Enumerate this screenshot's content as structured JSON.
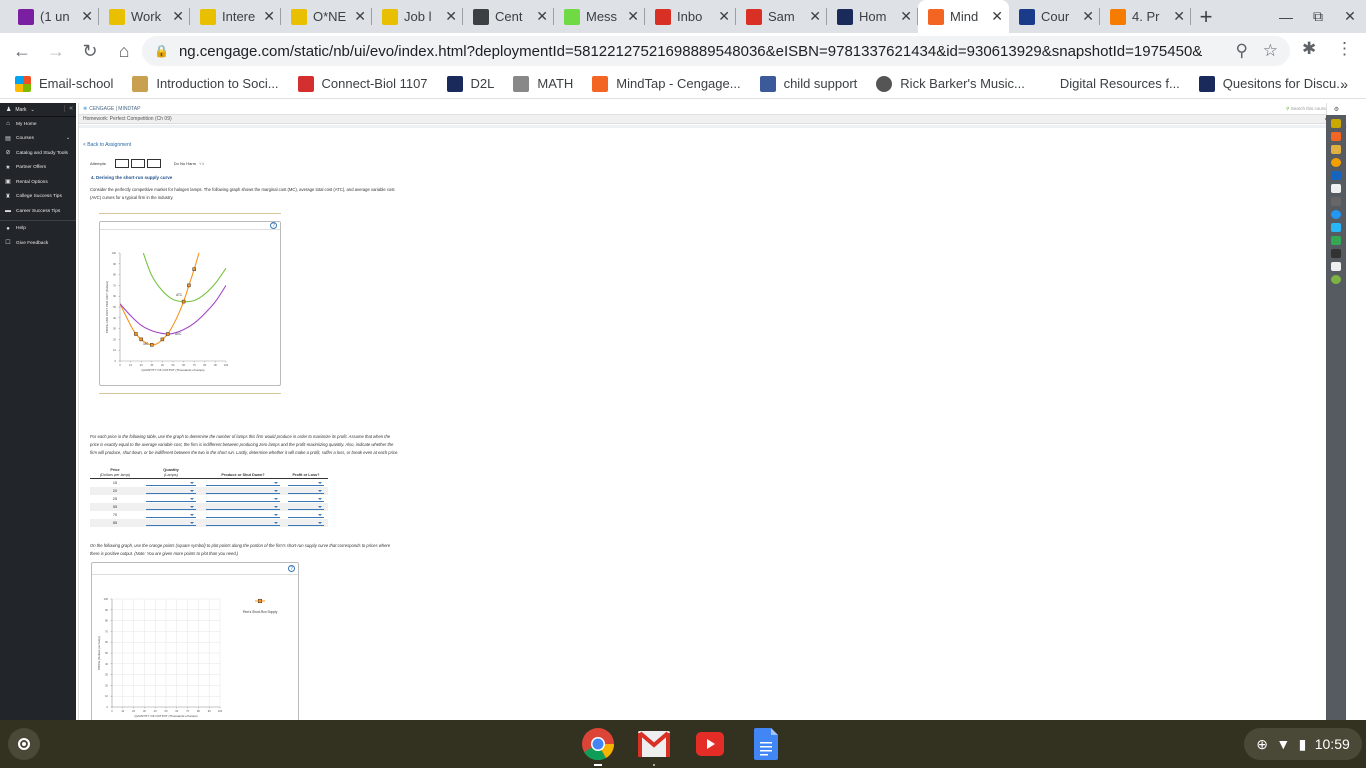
{
  "browser": {
    "tabs": [
      {
        "title": "(1 un",
        "icon": "mail-icon",
        "color": "#7b1fa2"
      },
      {
        "title": "Work",
        "icon": "onet-icon",
        "color": "#e8c000"
      },
      {
        "title": "Intere",
        "icon": "onet-icon",
        "color": "#e8c000"
      },
      {
        "title": "O*NE",
        "icon": "onet-icon",
        "color": "#e8c000"
      },
      {
        "title": "Job l",
        "icon": "onet-icon",
        "color": "#e8c000"
      },
      {
        "title": "Cent",
        "icon": "compass-icon",
        "color": "#3c4043"
      },
      {
        "title": "Mess",
        "icon": "upwork-icon",
        "color": "#6fda44"
      },
      {
        "title": "Inbo",
        "icon": "gmail-icon",
        "color": "#d93025"
      },
      {
        "title": "Sam",
        "icon": "gmail-icon",
        "color": "#d93025"
      },
      {
        "title": "Hom",
        "icon": "d2l-icon",
        "color": "#1a2a5a"
      },
      {
        "title": "Mind",
        "icon": "mindtap-icon",
        "color": "#f26522",
        "active": true
      },
      {
        "title": "Cour",
        "icon": "shield-icon",
        "color": "#1a3a8a"
      },
      {
        "title": "4. Pr",
        "icon": "cengage-c-icon",
        "color": "#f57c00"
      }
    ],
    "url": "ng.cengage.com/static/nb/ui/evo/index.html?deploymentId=58122127521698889548036&eISBN=9781337621434&id=930613929&snapshotId=1975450&",
    "bookmarks": [
      {
        "label": "Email-school",
        "icon": "microsoft-icon"
      },
      {
        "label": "Introduction to Soci...",
        "icon": "books-icon"
      },
      {
        "label": "Connect-Biol 1107",
        "icon": "mcgraw-hill-icon"
      },
      {
        "label": "D2L",
        "icon": "d2l-icon"
      },
      {
        "label": "MATH",
        "icon": "tablet-icon"
      },
      {
        "label": "MindTap - Cengage...",
        "icon": "mindtap-icon"
      },
      {
        "label": "child support",
        "icon": "hhs-icon"
      },
      {
        "label": "Rick Barker's Music...",
        "icon": "globe-icon"
      },
      {
        "label": "Digital Resources f...",
        "icon": ""
      },
      {
        "label": "Quesitons for Discu...",
        "icon": "d2l-icon"
      }
    ]
  },
  "sidebar": {
    "user": "Mark",
    "items": [
      {
        "label": "My Home",
        "icon": "home-icon"
      },
      {
        "label": "Courses",
        "icon": "courses-icon"
      },
      {
        "label": "Catalog and Study Tools",
        "icon": "catalog-icon"
      },
      {
        "label": "Partner Offers",
        "icon": "star-icon"
      },
      {
        "label": "Rental Options",
        "icon": "rental-icon"
      },
      {
        "label": "College Success Tips",
        "icon": "grad-cap-icon"
      },
      {
        "label": "Career Success Tips",
        "icon": "briefcase-icon"
      },
      {
        "label": "Help",
        "icon": "help-icon"
      },
      {
        "label": "Give Feedback",
        "icon": "feedback-icon"
      }
    ]
  },
  "header": {
    "brand": "CENGAGE | MINDTAP",
    "search_placeholder": "Search this course",
    "assignment_title": "Homework: Perfect Competition (Ch 09)"
  },
  "content": {
    "back_link": "< Back to Assignment",
    "attempts_label": "Attempts",
    "do_no_harm_label": "Do No Harm",
    "do_no_harm_value": "Y4",
    "question_title": "4. Deriving the short-run supply curve",
    "intro": "Consider the perfectly competitive market for halogen lamps. The following graph shows the marginal cost (MC), average total cost (ATC), and average variable cost (AVC) curves for a typical firm in the industry.",
    "table_instructions": "For each price in the following table, use the graph to determine the number of lamps this firm would produce in order to maximize its profit. Assume that when the price is exactly equal to the average variable cost, the firm is indifferent between producing zero lamps and the profit-maximizing quantity. Also, indicate whether the firm will produce, shut down, or be indifferent between the two in the short run. Lastly, determine whether it will make a profit, suffer a loss, or break even at each price.",
    "table": {
      "headers": {
        "price": "Price",
        "price_unit": "(Dollars per lamp)",
        "quantity": "Quantity",
        "quantity_unit": "(Lamps)",
        "produce": "Produce or Shut Down?",
        "profit": "Profit or Loss?"
      },
      "rows": [
        {
          "price": "15"
        },
        {
          "price": "20"
        },
        {
          "price": "25"
        },
        {
          "price": "55"
        },
        {
          "price": "70"
        },
        {
          "price": "85"
        }
      ]
    },
    "graph_instructions": "On the following graph, use the orange points (square symbol) to plot points along the portion of the firm's short-run supply curve that corresponds to prices where there is positive output. (Note: You are given more points to plot than you need.)",
    "legend_label": "Firm's Short-Run Supply"
  },
  "chart_data": [
    {
      "type": "line",
      "title": "",
      "xlabel": "QUANTITY OF OUTPUT (Thousands of lamps)",
      "ylabel": "PRICE AND COST PER UNIT (Dollars)",
      "xlim": [
        0,
        100
      ],
      "ylim": [
        0,
        100
      ],
      "xticks": [
        0,
        10,
        20,
        30,
        40,
        50,
        60,
        70,
        80,
        90,
        100
      ],
      "yticks": [
        0,
        10,
        20,
        30,
        40,
        50,
        60,
        70,
        80,
        90,
        100
      ],
      "grid": false,
      "series": [
        {
          "name": "MC",
          "color": "#f7941d",
          "x": [
            0,
            10,
            15,
            20,
            25,
            30,
            35,
            40,
            45,
            50,
            55,
            60,
            65,
            70,
            75
          ],
          "y": [
            53,
            33,
            25,
            20,
            16.5,
            15,
            16,
            20,
            25,
            33,
            43,
            55,
            70,
            85,
            102
          ]
        },
        {
          "name": "ATC",
          "color": "#76c442",
          "x": [
            22,
            30,
            40,
            50,
            60,
            70,
            80,
            90,
            100
          ],
          "y": [
            100,
            79,
            65,
            57,
            55,
            56,
            62,
            72,
            86
          ]
        },
        {
          "name": "AVC",
          "color": "#a346c8",
          "x": [
            0,
            10,
            20,
            30,
            40,
            45,
            50,
            60,
            70,
            80,
            90,
            100
          ],
          "y": [
            53,
            42,
            33,
            28,
            25.5,
            25,
            25.5,
            29,
            35,
            44,
            55,
            70
          ]
        }
      ],
      "marked_points": [
        {
          "x": 15,
          "y": 25
        },
        {
          "x": 20,
          "y": 20
        },
        {
          "x": 30,
          "y": 15
        },
        {
          "x": 40,
          "y": 20
        },
        {
          "x": 45,
          "y": 25
        },
        {
          "x": 60,
          "y": 55
        },
        {
          "x": 65,
          "y": 70
        },
        {
          "x": 70,
          "y": 85
        }
      ],
      "annotations": [
        "ATC",
        "AVC",
        "MC"
      ]
    },
    {
      "type": "scatter",
      "title": "",
      "xlabel": "QUANTITY OF OUTPUT (Thousands of lamps)",
      "ylabel": "PRICE (Dollars per lamp)",
      "xlim": [
        0,
        100
      ],
      "ylim": [
        0,
        100
      ],
      "xticks": [
        0,
        10,
        20,
        30,
        40,
        50,
        60,
        70,
        80,
        90,
        100
      ],
      "yticks": [
        0,
        10,
        20,
        30,
        40,
        50,
        60,
        70,
        80,
        90,
        100
      ],
      "grid": true,
      "legend": "right",
      "series": [
        {
          "name": "Firm's Short-Run Supply",
          "color": "#f7941d",
          "x": [],
          "y": []
        }
      ]
    }
  ],
  "shelf": {
    "apps": [
      "chrome-icon",
      "gmail-icon",
      "youtube-icon",
      "docs-icon"
    ],
    "time": "10:59"
  }
}
